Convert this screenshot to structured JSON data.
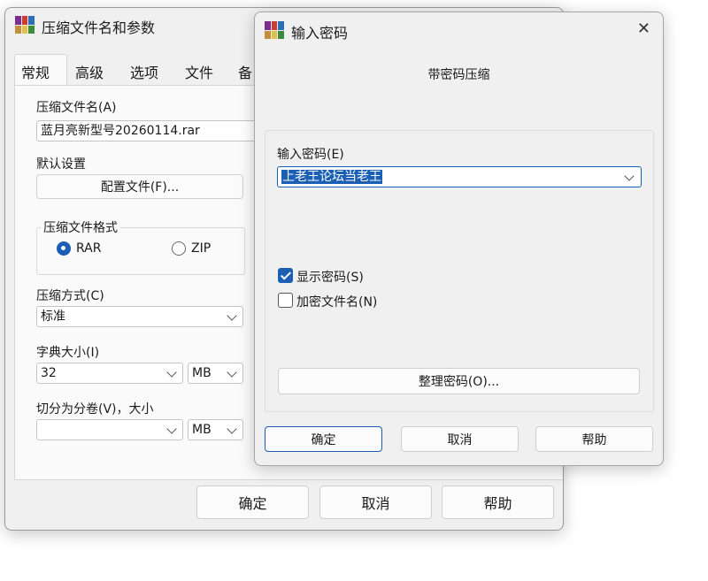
{
  "main_dialog": {
    "title": "压缩文件名和参数",
    "tabs": [
      "常规",
      "高级",
      "选项",
      "文件",
      "备"
    ],
    "archive_name_label": "压缩文件名(A)",
    "archive_name_value": "蓝月亮新型号20260114.rar",
    "default_settings_label": "默认设置",
    "profiles_button": "配置文件(F)...",
    "format_group_label": "压缩文件格式",
    "format_options": [
      "RAR",
      "ZIP"
    ],
    "format_selected": "RAR",
    "method_label": "压缩方式(C)",
    "method_value": "标准",
    "dict_label": "字典大小(I)",
    "dict_value": "32",
    "dict_unit": "MB",
    "split_label": "切分为分卷(V)，大小",
    "split_value": "",
    "split_unit": "MB",
    "ok": "确定",
    "cancel": "取消",
    "help": "帮助"
  },
  "password_dialog": {
    "title": "输入密码",
    "heading": "带密码压缩",
    "password_label": "输入密码(E)",
    "password_value": "上老王论坛当老王",
    "show_password_label": "显示密码(S)",
    "show_password_checked": true,
    "encrypt_names_label": "加密文件名(N)",
    "encrypt_names_checked": false,
    "organize_button": "整理密码(O)...",
    "ok": "确定",
    "cancel": "取消",
    "help": "帮助",
    "close_glyph": "✕"
  }
}
